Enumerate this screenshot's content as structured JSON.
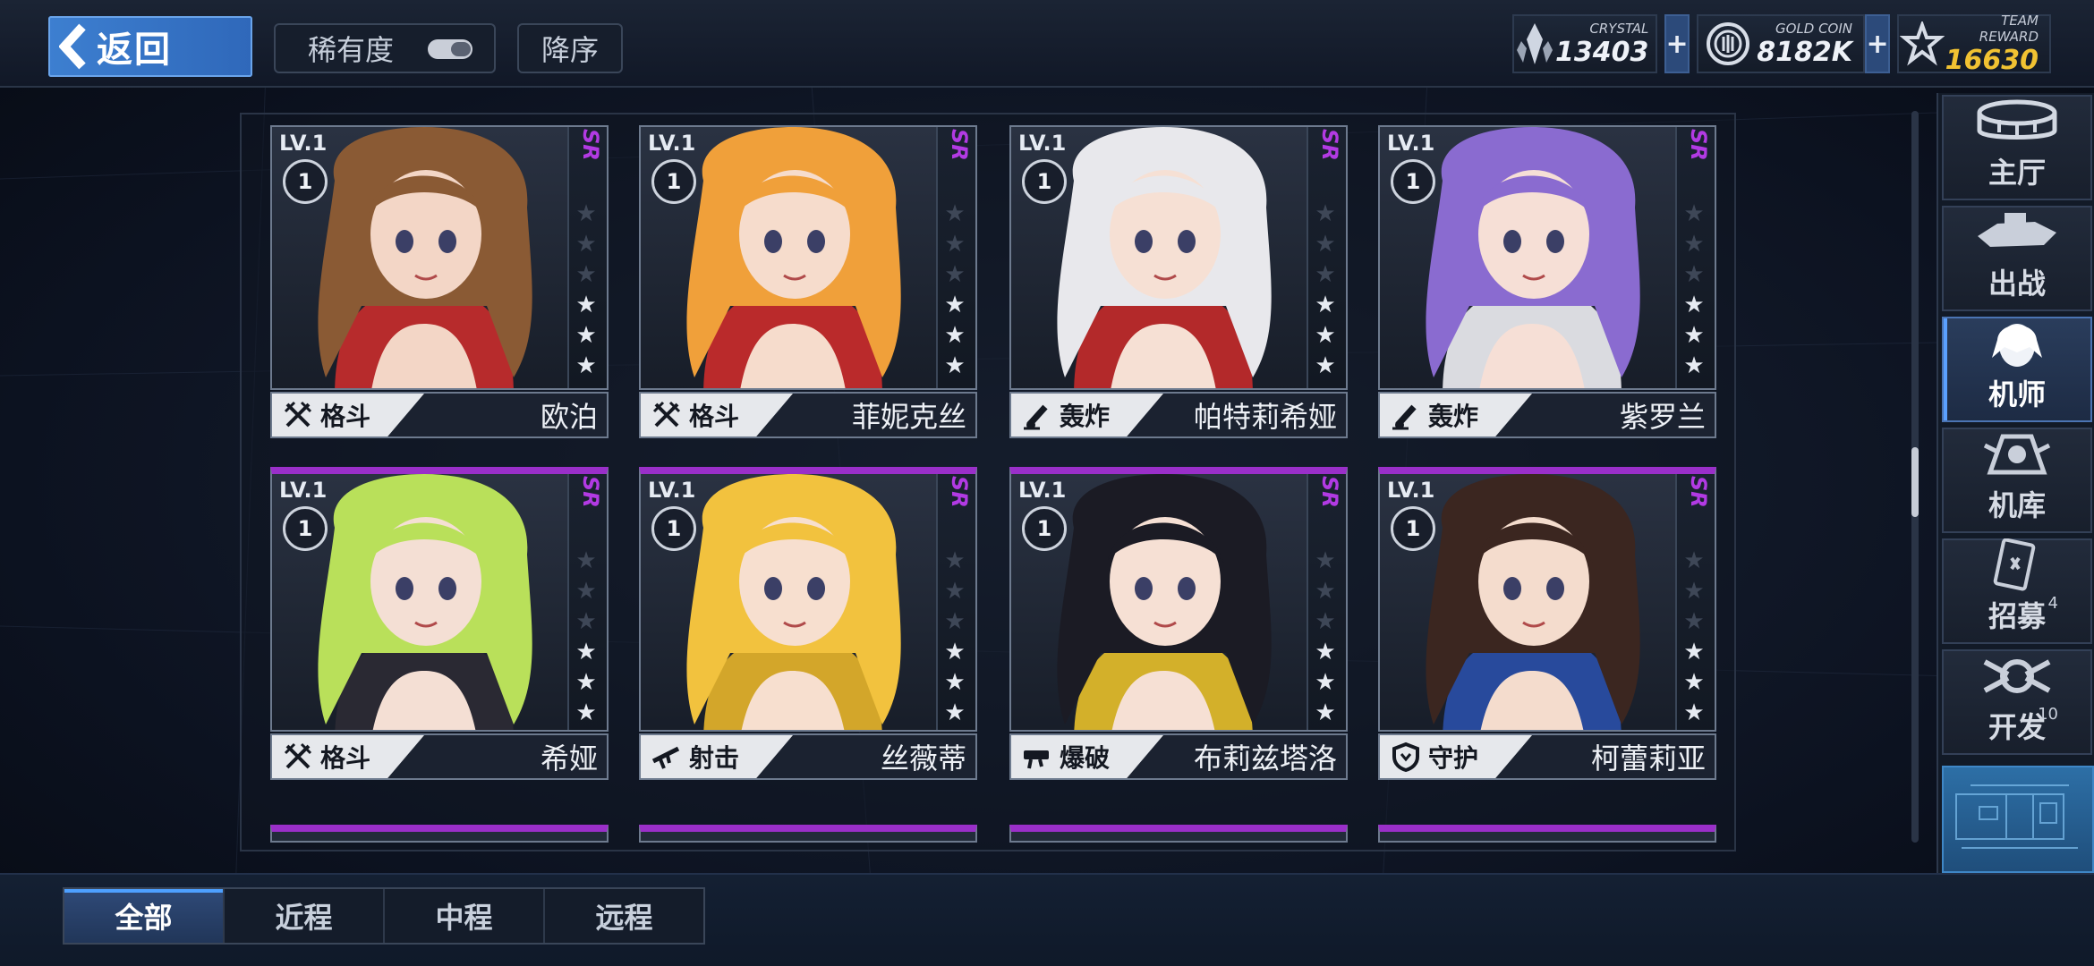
{
  "topbar": {
    "back_label": "返回",
    "rarity_label": "稀有度",
    "order_label": "降序",
    "resources": [
      {
        "caption": "CRYSTAL",
        "value": "13403",
        "icon": "crystal-icon"
      },
      {
        "caption": "GOLD COIN",
        "value": "8182K",
        "icon": "gold-coin-icon"
      },
      {
        "caption": "TEAM REWARD",
        "value": "16630",
        "icon": "team-reward-icon"
      }
    ],
    "plus_label": "+"
  },
  "cards": [
    {
      "lv": "LV.1",
      "level": "1",
      "rarity": "SR",
      "stars": 3,
      "type": "格斗",
      "type_icon": "crossed-swords-icon",
      "name": "欧泊",
      "hair": "#8a5a34",
      "skin": "#f3d6c6",
      "accent": "#c92c2c"
    },
    {
      "lv": "LV.1",
      "level": "1",
      "rarity": "SR",
      "stars": 3,
      "type": "格斗",
      "type_icon": "crossed-swords-icon",
      "name": "菲妮克丝",
      "hair": "#f0a03a",
      "skin": "#f6dccc",
      "accent": "#cc2b2b"
    },
    {
      "lv": "LV.1",
      "level": "1",
      "rarity": "SR",
      "stars": 3,
      "type": "轰炸",
      "type_icon": "mortar-icon",
      "name": "帕特莉希娅",
      "hair": "#e8e8ec",
      "skin": "#f6e0d4",
      "accent": "#c42a2a"
    },
    {
      "lv": "LV.1",
      "level": "1",
      "rarity": "SR",
      "stars": 3,
      "type": "轰炸",
      "type_icon": "mortar-icon",
      "name": "紫罗兰",
      "hair": "#8a6bd0",
      "skin": "#f6dfd6",
      "accent": "#f0f0f4"
    },
    {
      "lv": "LV.1",
      "level": "1",
      "rarity": "SR",
      "stars": 3,
      "type": "格斗",
      "type_icon": "crossed-swords-icon",
      "name": "希娅",
      "hair": "#b9e05a",
      "skin": "#f4dfd4",
      "accent": "#2c2a34"
    },
    {
      "lv": "LV.1",
      "level": "1",
      "rarity": "SR",
      "stars": 3,
      "type": "射击",
      "type_icon": "rifle-icon",
      "name": "丝薇蒂",
      "hair": "#f2c23e",
      "skin": "#f7dfcf",
      "accent": "#e8b52a"
    },
    {
      "lv": "LV.1",
      "level": "1",
      "rarity": "SR",
      "stars": 3,
      "type": "爆破",
      "type_icon": "launcher-icon",
      "name": "布莉兹塔洛",
      "hair": "#1b1b24",
      "skin": "#f6e0d4",
      "accent": "#e8c02a"
    },
    {
      "lv": "LV.1",
      "level": "1",
      "rarity": "SR",
      "stars": 3,
      "type": "守护",
      "type_icon": "shield-icon",
      "name": "柯蕾莉亚",
      "hair": "#3b2620",
      "skin": "#f4dccd",
      "accent": "#2a4fa8"
    }
  ],
  "nav": [
    {
      "label": "主厅",
      "icon": "hall-icon",
      "badge": ""
    },
    {
      "label": "出战",
      "icon": "sortie-icon",
      "badge": ""
    },
    {
      "label": "机师",
      "icon": "pilot-icon",
      "badge": "",
      "active": true
    },
    {
      "label": "机库",
      "icon": "hangar-icon",
      "badge": ""
    },
    {
      "label": "招募",
      "icon": "recruit-icon",
      "badge": "4"
    },
    {
      "label": "开发",
      "icon": "develop-icon",
      "badge": "10"
    }
  ],
  "tabs": [
    {
      "label": "全部",
      "active": true
    },
    {
      "label": "近程"
    },
    {
      "label": "中程"
    },
    {
      "label": "远程"
    }
  ],
  "colors": {
    "rank": "#b23ae3",
    "reward": "#f1c232",
    "accent_blue": "#3d7fd0"
  }
}
